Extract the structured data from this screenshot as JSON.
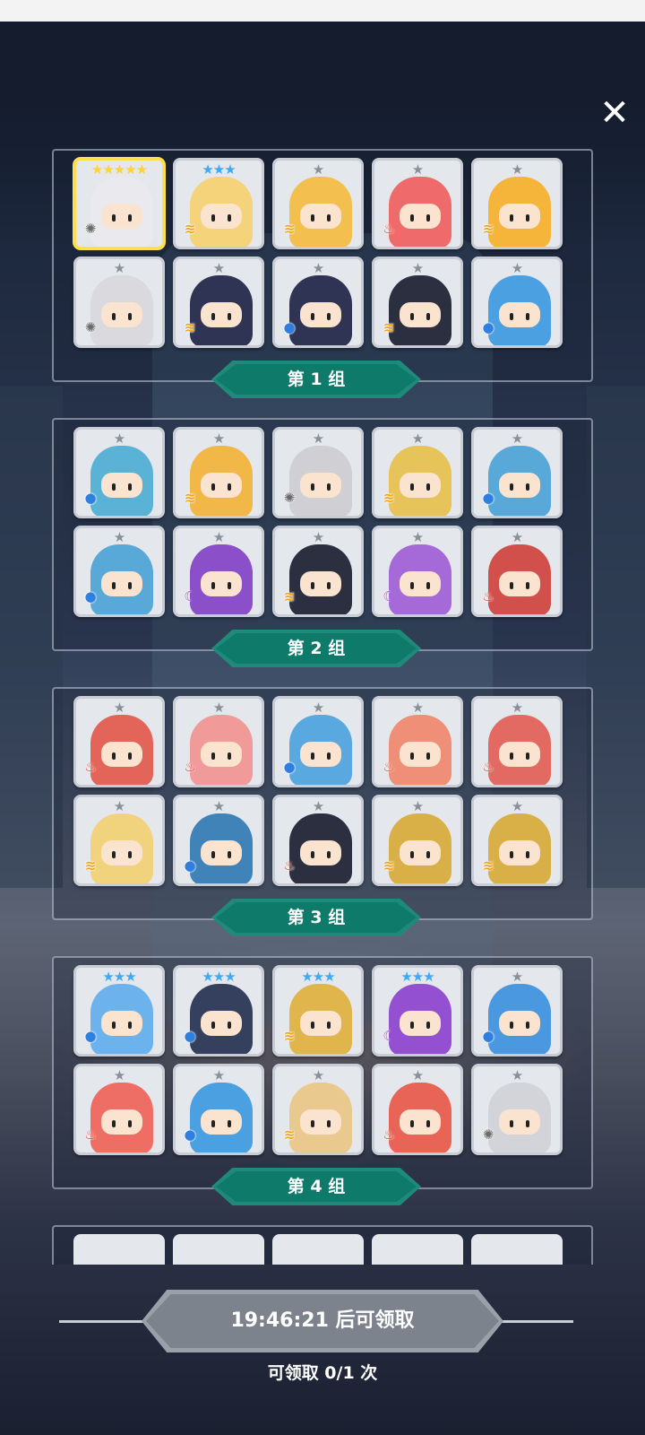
{
  "close": {
    "icon": "close-icon",
    "glyph": "✕"
  },
  "groups": [
    {
      "label": "第 1 组",
      "rows": [
        [
          {
            "stars": "★★★★★",
            "star_color": "#ffd23a",
            "element": "light",
            "portrait_color": "#e9e9ee",
            "selected": true
          },
          {
            "stars": "★★★",
            "star_color": "#3fa9f5",
            "element": "wind",
            "portrait_color": "#f5d37a"
          },
          {
            "stars": "★",
            "star_color": "#8a8f98",
            "element": "wind",
            "portrait_color": "#f3c04f"
          },
          {
            "stars": "★",
            "star_color": "#8a8f98",
            "element": "fire",
            "portrait_color": "#ef6b6b"
          },
          {
            "stars": "★",
            "star_color": "#8a8f98",
            "element": "wind",
            "portrait_color": "#f5b53b"
          }
        ],
        [
          {
            "stars": "★",
            "star_color": "#8a8f98",
            "element": "light",
            "portrait_color": "#d9d9de"
          },
          {
            "stars": "★",
            "star_color": "#8a8f98",
            "element": "wind",
            "portrait_color": "#2f3354"
          },
          {
            "stars": "★",
            "star_color": "#8a8f98",
            "element": "water",
            "portrait_color": "#2f3354"
          },
          {
            "stars": "★",
            "star_color": "#8a8f98",
            "element": "wind",
            "portrait_color": "#2b2f40"
          },
          {
            "stars": "★",
            "star_color": "#8a8f98",
            "element": "water",
            "portrait_color": "#4aa0e0"
          }
        ]
      ]
    },
    {
      "label": "第 2 组",
      "rows": [
        [
          {
            "stars": "★",
            "star_color": "#8a8f98",
            "element": "water",
            "portrait_color": "#5ab3d6"
          },
          {
            "stars": "★",
            "star_color": "#8a8f98",
            "element": "wind",
            "portrait_color": "#f1b847"
          },
          {
            "stars": "★",
            "star_color": "#8a8f98",
            "element": "light",
            "portrait_color": "#cfcfd4"
          },
          {
            "stars": "★",
            "star_color": "#8a8f98",
            "element": "wind",
            "portrait_color": "#e6c45a"
          },
          {
            "stars": "★",
            "star_color": "#8a8f98",
            "element": "water",
            "portrait_color": "#58a8d8"
          }
        ],
        [
          {
            "stars": "★",
            "star_color": "#8a8f98",
            "element": "water",
            "portrait_color": "#58a8d8"
          },
          {
            "stars": "★",
            "star_color": "#8a8f98",
            "element": "dark",
            "portrait_color": "#8a4fc9"
          },
          {
            "stars": "★",
            "star_color": "#8a8f98",
            "element": "wind",
            "portrait_color": "#2b2f40"
          },
          {
            "stars": "★",
            "star_color": "#8a8f98",
            "element": "dark",
            "portrait_color": "#a56ad8"
          },
          {
            "stars": "★",
            "star_color": "#8a8f98",
            "element": "fire",
            "portrait_color": "#d2504b"
          }
        ]
      ]
    },
    {
      "label": "第 3 组",
      "rows": [
        [
          {
            "stars": "★",
            "star_color": "#8a8f98",
            "element": "fire",
            "portrait_color": "#e3655a"
          },
          {
            "stars": "★",
            "star_color": "#8a8f98",
            "element": "fire",
            "portrait_color": "#f19a9a"
          },
          {
            "stars": "★",
            "star_color": "#8a8f98",
            "element": "water",
            "portrait_color": "#59a9e0"
          },
          {
            "stars": "★",
            "star_color": "#8a8f98",
            "element": "fire",
            "portrait_color": "#ef8f78"
          },
          {
            "stars": "★",
            "star_color": "#8a8f98",
            "element": "fire",
            "portrait_color": "#e26a63"
          }
        ],
        [
          {
            "stars": "★",
            "star_color": "#8a8f98",
            "element": "wind",
            "portrait_color": "#f1d37e"
          },
          {
            "stars": "★",
            "star_color": "#8a8f98",
            "element": "water",
            "portrait_color": "#3f83b9"
          },
          {
            "stars": "★",
            "star_color": "#8a8f98",
            "element": "fire",
            "portrait_color": "#2b2f40"
          },
          {
            "stars": "★",
            "star_color": "#8a8f98",
            "element": "wind",
            "portrait_color": "#d9b048"
          },
          {
            "stars": "★",
            "star_color": "#8a8f98",
            "element": "wind",
            "portrait_color": "#d9b048"
          }
        ]
      ]
    },
    {
      "label": "第 4 组",
      "rows": [
        [
          {
            "stars": "★★★",
            "star_color": "#3fa9f5",
            "element": "water",
            "portrait_color": "#6cb3ee"
          },
          {
            "stars": "★★★",
            "star_color": "#3fa9f5",
            "element": "water",
            "portrait_color": "#34405e"
          },
          {
            "stars": "★★★",
            "star_color": "#3fa9f5",
            "element": "wind",
            "portrait_color": "#e0b54b"
          },
          {
            "stars": "★★★",
            "star_color": "#3fa9f5",
            "element": "dark",
            "portrait_color": "#9350d0"
          },
          {
            "stars": "★",
            "star_color": "#8a8f98",
            "element": "water",
            "portrait_color": "#4a98e0"
          }
        ],
        [
          {
            "stars": "★",
            "star_color": "#8a8f98",
            "element": "fire",
            "portrait_color": "#ee6e66"
          },
          {
            "stars": "★",
            "star_color": "#8a8f98",
            "element": "water",
            "portrait_color": "#4aa0e0"
          },
          {
            "stars": "★",
            "star_color": "#8a8f98",
            "element": "wind",
            "portrait_color": "#e9c98d"
          },
          {
            "stars": "★",
            "star_color": "#8a8f98",
            "element": "fire",
            "portrait_color": "#e86457"
          },
          {
            "stars": "★",
            "star_color": "#8a8f98",
            "element": "light",
            "portrait_color": "#d3d3da"
          }
        ]
      ]
    }
  ],
  "element_icons": {
    "light": {
      "glyph": "✺",
      "color": "#6b6b6b"
    },
    "wind": {
      "glyph": "≋",
      "color": "#f1a318"
    },
    "fire": {
      "glyph": "♨",
      "color": "#e0412f"
    },
    "water": {
      "glyph": "●",
      "color": "#2e7fe0"
    },
    "dark": {
      "glyph": "☾",
      "color": "#b04ad0"
    }
  },
  "claim": {
    "button_label": "19:46:21 后可领取",
    "count_label": "可领取 0/1 次"
  },
  "colors": {
    "ribbon": "#0e7a6a",
    "selected_border": "#ffe04a",
    "claim_disabled": "#7d838c"
  }
}
